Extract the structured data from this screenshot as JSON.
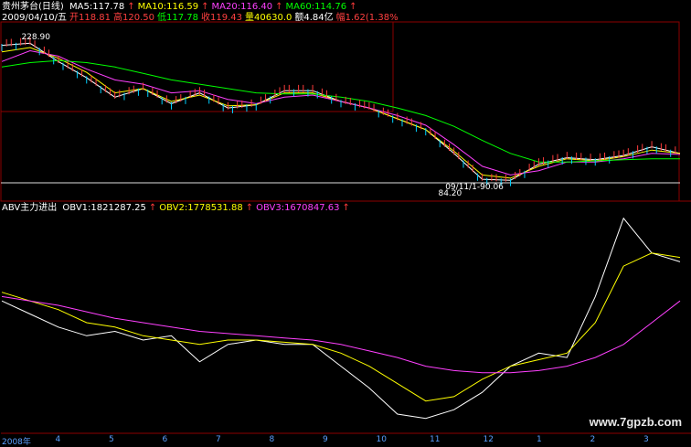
{
  "header": {
    "stock": "贵州茅台(日线)",
    "ma": [
      {
        "label": "MA5:117.78",
        "color": "#ffffff"
      },
      {
        "label": "MA10:116.59",
        "color": "#ffff00"
      },
      {
        "label": "MA20:116.40",
        "color": "#ff40ff"
      },
      {
        "label": "MA60:114.76",
        "color": "#00ff00"
      }
    ],
    "arrow": "↑",
    "info": [
      {
        "label": "2009/04/10/五",
        "color": "#ffffff"
      },
      {
        "label": "开118.81",
        "color": "#ff4040"
      },
      {
        "label": "高120.50",
        "color": "#ff4040"
      },
      {
        "label": "低117.78",
        "color": "#00ff00"
      },
      {
        "label": "收119.43",
        "color": "#ff4040"
      },
      {
        "label": "量40630.0",
        "color": "#ffff00"
      },
      {
        "label": "额4.84亿",
        "color": "#ffffff"
      },
      {
        "label": "幅1.62(1.38%",
        "color": "#ff4040"
      }
    ]
  },
  "indicator": {
    "title": "ABV主力进出",
    "lines": [
      {
        "label": "OBV1:1821287.25",
        "color": "#ffffff"
      },
      {
        "label": "OBV2:1778531.88",
        "color": "#ffff00"
      },
      {
        "label": "OBV3:1670847.63",
        "color": "#ff40ff"
      }
    ]
  },
  "watermark": "www.7gpzb.com",
  "chart_data": [
    {
      "type": "line",
      "panel": "price",
      "annotations": [
        {
          "text": "228.90",
          "x": 4,
          "y": 228.9
        },
        {
          "text": "84.20",
          "x": 122,
          "y": 84.2
        },
        {
          "text": "09/11/1-90.06",
          "x": 124,
          "y": 90.06
        }
      ],
      "ylim": [
        80,
        240
      ],
      "x": [
        0,
        8,
        16,
        24,
        32,
        40,
        48,
        56,
        64,
        72,
        80,
        88,
        96,
        104,
        112,
        120,
        128,
        136,
        144,
        152,
        160,
        168,
        176,
        184,
        192
      ],
      "series": [
        {
          "name": "MA5",
          "color": "#ffffff",
          "values": [
            220,
            222,
            205,
            190,
            172,
            180,
            166,
            176,
            162,
            165,
            178,
            178,
            168,
            162,
            152,
            142,
            120,
            96,
            95,
            110,
            116,
            114,
            118,
            126,
            120
          ]
        },
        {
          "name": "MA10",
          "color": "#ffff00",
          "values": [
            214,
            218,
            208,
            195,
            176,
            180,
            168,
            174,
            164,
            165,
            176,
            176,
            168,
            162,
            152,
            142,
            122,
            100,
            97,
            108,
            115,
            113,
            117,
            123,
            120
          ]
        },
        {
          "name": "MA20",
          "color": "#ff40ff",
          "values": [
            205,
            215,
            210,
            198,
            188,
            184,
            176,
            178,
            170,
            166,
            172,
            174,
            168,
            162,
            155,
            146,
            128,
            108,
            100,
            104,
            112,
            112,
            115,
            120,
            119
          ]
        },
        {
          "name": "MA60",
          "color": "#00ff00",
          "values": [
            200,
            204,
            206,
            204,
            200,
            194,
            188,
            184,
            180,
            176,
            175,
            175,
            172,
            168,
            162,
            155,
            145,
            132,
            120,
            112,
            112,
            113,
            114,
            115,
            115
          ]
        }
      ]
    },
    {
      "type": "line",
      "panel": "ABV",
      "ylim": [
        0,
        100
      ],
      "categories": [
        "2008年",
        "4",
        "5",
        "6",
        "7",
        "8",
        "9",
        "10",
        "11",
        "12",
        "1",
        "2",
        "3"
      ],
      "x": [
        0,
        8,
        16,
        24,
        32,
        40,
        48,
        56,
        64,
        72,
        80,
        88,
        96,
        104,
        112,
        120,
        128,
        136,
        144,
        152,
        160,
        168,
        176,
        184,
        192
      ],
      "series": [
        {
          "name": "OBV1",
          "color": "#ffffff",
          "values": [
            60,
            54,
            48,
            44,
            46,
            42,
            44,
            32,
            40,
            42,
            40,
            40,
            30,
            20,
            8,
            6,
            10,
            18,
            30,
            36,
            34,
            62,
            98,
            82,
            78
          ]
        },
        {
          "name": "OBV2",
          "color": "#ffff00",
          "values": [
            64,
            60,
            56,
            50,
            48,
            44,
            42,
            40,
            42,
            42,
            41,
            40,
            36,
            30,
            22,
            14,
            16,
            24,
            30,
            33,
            36,
            50,
            76,
            82,
            80
          ]
        },
        {
          "name": "OBV3",
          "color": "#ff40ff",
          "values": [
            62,
            60,
            58,
            55,
            52,
            50,
            48,
            46,
            45,
            44,
            43,
            42,
            40,
            37,
            34,
            30,
            28,
            27,
            27,
            28,
            30,
            34,
            40,
            50,
            60
          ]
        }
      ]
    }
  ]
}
